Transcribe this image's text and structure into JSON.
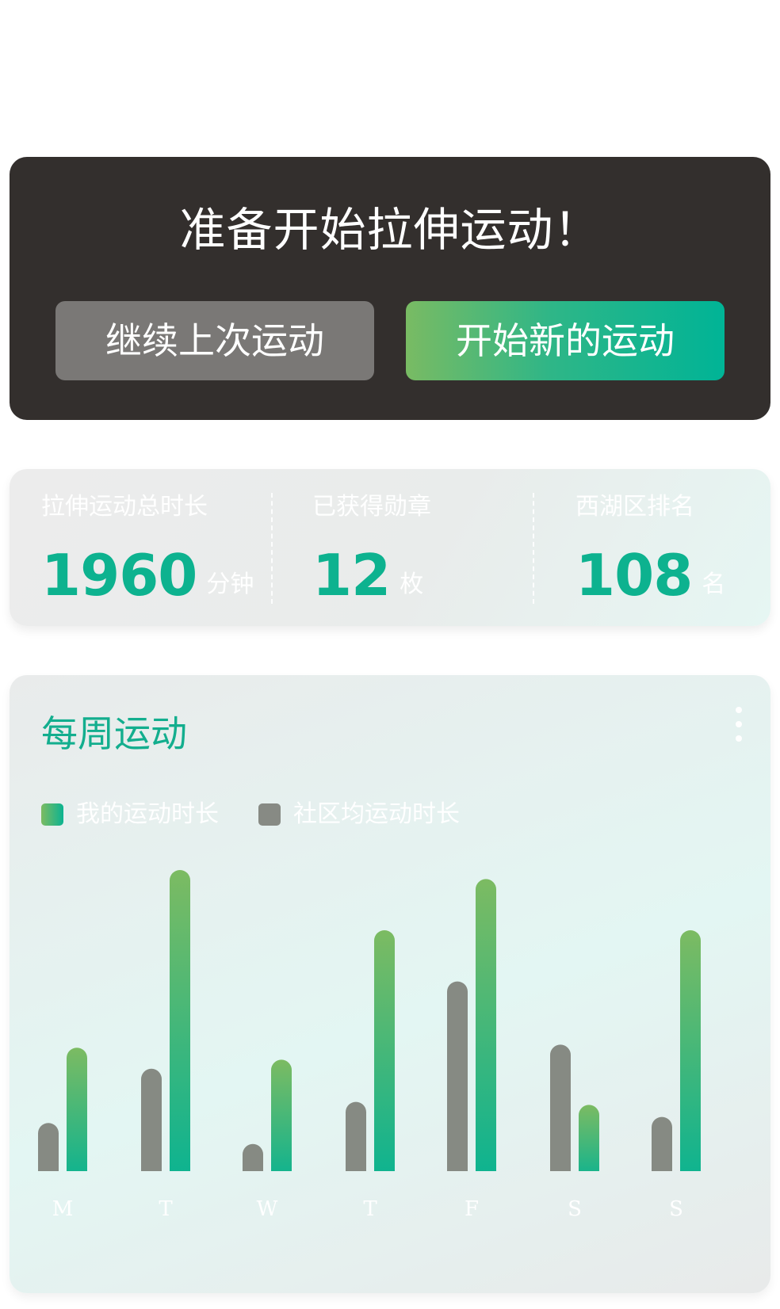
{
  "hero": {
    "title": "准备开始拉伸运动！",
    "continue_label": "继续上次运动",
    "start_label": "开始新的运动"
  },
  "stats": [
    {
      "label": "拉伸运动总时长",
      "value": "1960",
      "unit": "分钟"
    },
    {
      "label": "已获得勋章",
      "value": "12",
      "unit": "枚"
    },
    {
      "label": "西湖区排名",
      "value": "108",
      "unit": "名"
    }
  ],
  "weekly": {
    "title": "每周运动",
    "more_icon": "more-vertical-icon",
    "legend": [
      {
        "label": "我的运动时长",
        "color": "#1db98f"
      },
      {
        "label": "社区均运动时长",
        "color": "#878a84"
      }
    ]
  },
  "chart_data": {
    "type": "bar",
    "categories": [
      "M",
      "T",
      "W",
      "T",
      "F",
      "S",
      "S"
    ],
    "series": [
      {
        "name": "社区均运动时长",
        "values": [
          16,
          34,
          9,
          23,
          63,
          42,
          18
        ]
      },
      {
        "name": "我的运动时长",
        "values": [
          41,
          100,
          37,
          80,
          97,
          22,
          80
        ]
      }
    ],
    "ylim": [
      0,
      100
    ],
    "grid": false,
    "legend": "top-left",
    "colors": {
      "community": "#868a83",
      "mine_top": "#7cbb62",
      "mine_bottom": "#0bb391"
    }
  }
}
